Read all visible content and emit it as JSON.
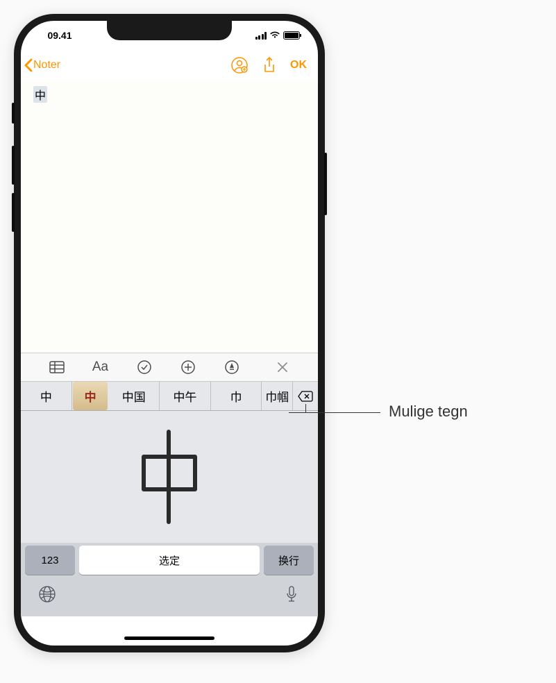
{
  "status": {
    "time": "09.41"
  },
  "nav": {
    "back_label": "Noter",
    "ok_label": "OK"
  },
  "note": {
    "content_char": "中"
  },
  "toolbar": {
    "format_label": "Aa"
  },
  "candidates": [
    "中",
    "中",
    "中国",
    "中午",
    "巾",
    "巾帼"
  ],
  "keyboard": {
    "key_123": "123",
    "key_select": "选定",
    "key_return": "换行"
  },
  "callout": {
    "label": "Mulige tegn"
  },
  "icons": {
    "globe": "globe-icon",
    "mic": "mic-icon",
    "delete": "delete-icon",
    "share": "share-icon",
    "add_person": "add-person-icon"
  }
}
